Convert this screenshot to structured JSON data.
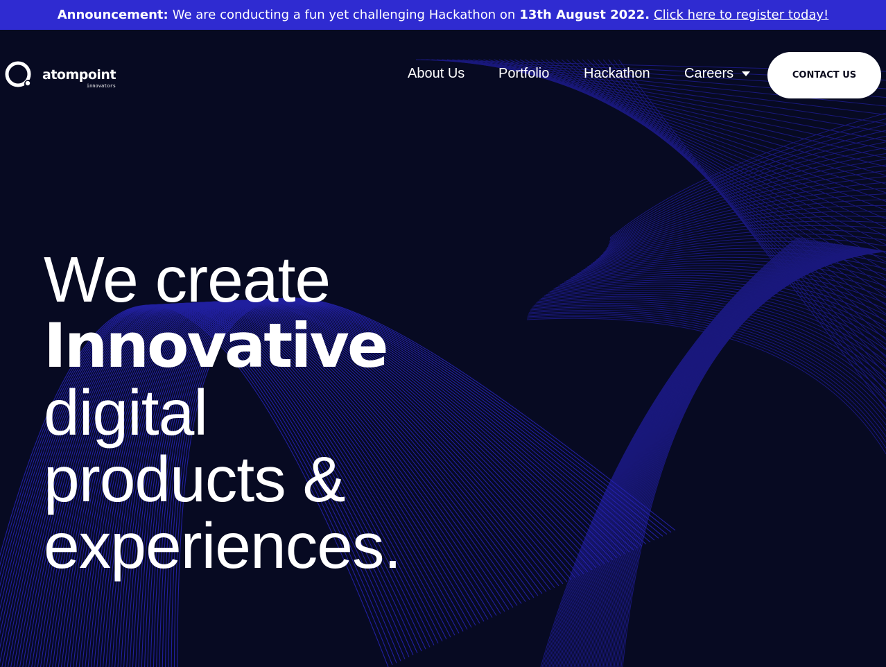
{
  "announcement": {
    "label": "Announcement:",
    "text": "We are conducting a fun yet challenging Hackathon on",
    "date": "13th August 2022.",
    "link": "Click here to register today!"
  },
  "brand": {
    "name": "atompoint",
    "tagline": "innovators",
    "icon": "atompoint-logo-icon"
  },
  "nav": {
    "about": "About Us",
    "portfolio": "Portfolio",
    "hackathon": "Hackathon",
    "careers": "Careers",
    "careers_icon": "caret-down-icon"
  },
  "contact_button": "CONTACT US",
  "hero": {
    "line1": "We create",
    "line2": "Innovative",
    "line3": "digital",
    "line4": "products &",
    "line5": "experiences."
  },
  "colors": {
    "announcement_bg": "#2f2bd1",
    "page_bg": "#070a22",
    "wave_lines": "#2a27c8",
    "button_bg": "#ffffff"
  }
}
